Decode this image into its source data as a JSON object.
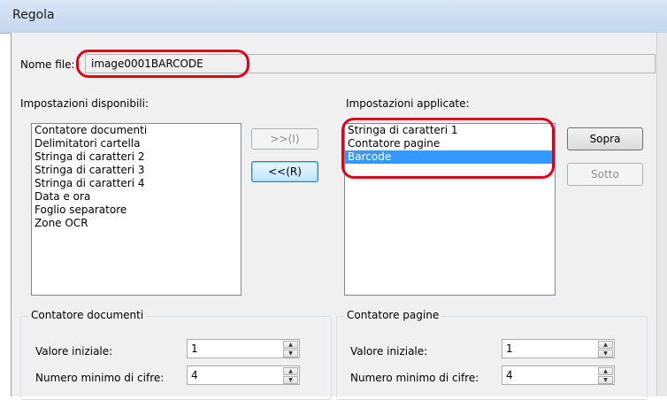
{
  "window": {
    "title": "Regola"
  },
  "filename": {
    "label": "Nome file:",
    "value": "image0001BARCODE"
  },
  "available": {
    "label": "Impostazioni disponibili:",
    "items": [
      "Contatore documenti",
      "Delimitatori cartella",
      "Stringa di caratteri 2",
      "Stringa di caratteri 3",
      "Stringa di caratteri 4",
      "Data e ora",
      "Foglio separatore",
      "Zone OCR"
    ]
  },
  "applied": {
    "label": "Impostazioni applicate:",
    "items": [
      "Stringa di caratteri 1",
      "Contatore pagine",
      "Barcode"
    ],
    "selected_index": 2
  },
  "buttons": {
    "add": ">>(I)",
    "remove": "<<(R)",
    "up": "Sopra",
    "down": "Sotto"
  },
  "doc_counter": {
    "title": "Contatore documenti",
    "initial_label": "Valore iniziale:",
    "initial_value": "1",
    "digits_label": "Numero minimo di cifre:",
    "digits_value": "4"
  },
  "page_counter": {
    "title": "Contatore pagine",
    "initial_label": "Valore iniziale:",
    "initial_value": "1",
    "digits_label": "Numero minimo di cifre:",
    "digits_value": "4"
  },
  "colors": {
    "selection": "#3399ff",
    "highlight": "#e0001a"
  },
  "icons": {
    "spin_up": "spin-up-arrow-icon",
    "spin_down": "spin-down-arrow-icon"
  }
}
